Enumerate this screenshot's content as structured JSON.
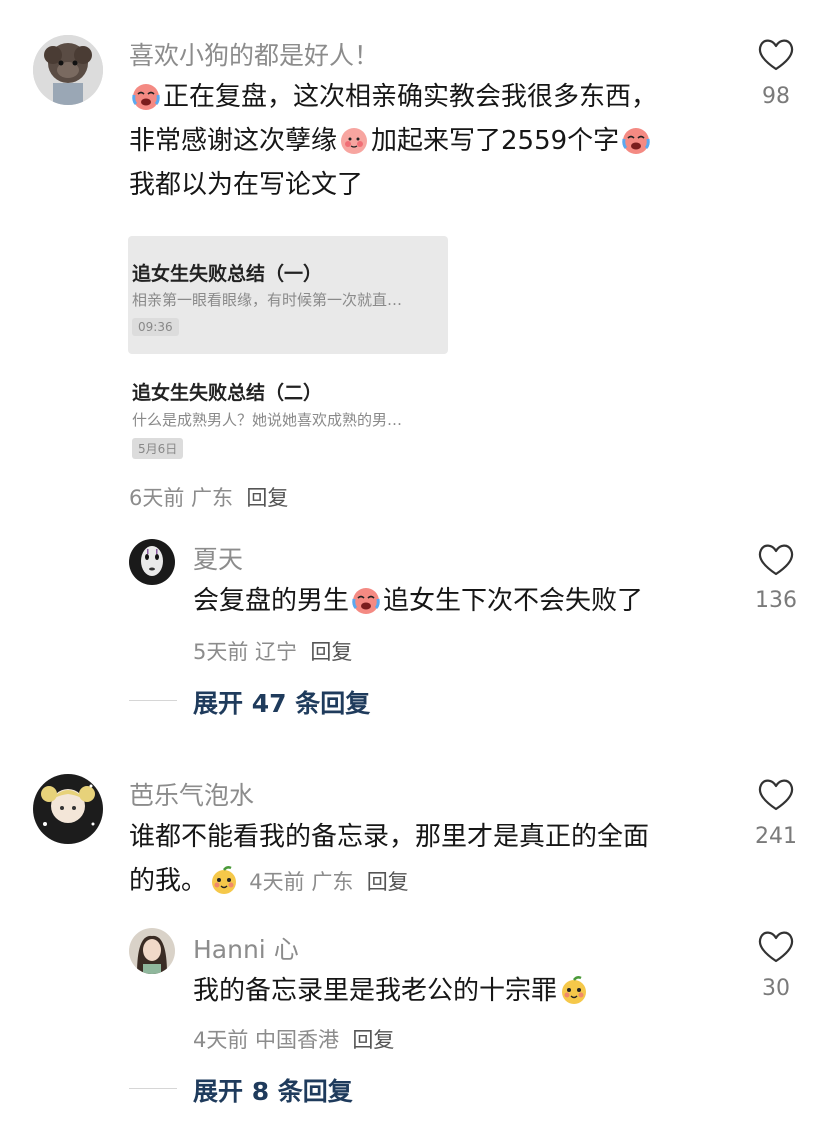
{
  "comments": [
    {
      "username": "喜欢小狗的都是好人！",
      "lines": [
        "正在复盘，这次相亲确实教会我很多东西，",
        "非常感谢这次孽缘",
        "加起来写了2559个字",
        "我都以为在写论文了"
      ],
      "likes": "98",
      "meta": "6天前 广东",
      "reply": "回复",
      "attachment": {
        "note1_title": "追女生失败总结（一）",
        "note1_sub": "相亲第一眼看眼缘，有时候第一次就直…",
        "note1_time": "09:36",
        "note2_title": "追女生失败总结（二）",
        "note2_sub": "什么是成熟男人？她说她喜欢成熟的男…",
        "note2_time": "5月6日"
      },
      "sub_reply": {
        "username": "夏天",
        "text_a": "会复盘的男生",
        "text_b": "追女生下次不会失败了",
        "likes": "136",
        "meta": "5天前 辽宁",
        "reply": "回复"
      },
      "expand": "展开 47 条回复"
    },
    {
      "username": "芭乐气泡水",
      "line1": "谁都不能看我的备忘录，那里才是真正的全面",
      "line2": "的我。",
      "meta": "4天前 广东",
      "reply": "回复",
      "likes": "241",
      "sub_reply": {
        "username": "Hanni 心",
        "text": "我的备忘录里是我老公的十宗罪",
        "likes": "30",
        "meta": "4天前 中国香港",
        "reply": "回复"
      },
      "expand": "展开 8 条回复"
    }
  ],
  "colors": {
    "text": "#161616",
    "muted": "#8c8c8c",
    "expand": "#1f3b5c",
    "background": "#ffffff"
  },
  "icons": [
    "heart-outline-icon",
    "crying-laugh-emoji",
    "shy-face-emoji",
    "smug-face-emoji"
  ]
}
